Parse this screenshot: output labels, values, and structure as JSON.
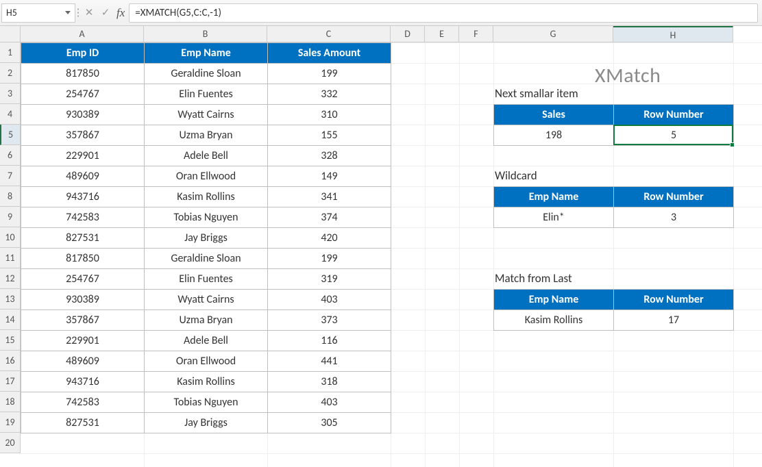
{
  "name_box": "H5",
  "formula": "=XMATCH(G5,C:C,-1)",
  "columns": [
    "A",
    "B",
    "C",
    "D",
    "E",
    "F",
    "G",
    "H"
  ],
  "rows": [
    "1",
    "2",
    "3",
    "4",
    "5",
    "6",
    "7",
    "8",
    "9",
    "10",
    "11",
    "12",
    "13",
    "14",
    "15",
    "16",
    "17",
    "18",
    "19",
    "20"
  ],
  "active_row": "5",
  "active_col": "H",
  "main_table": {
    "headers": [
      "Emp ID",
      "Emp Name",
      "Sales Amount"
    ],
    "rows": [
      [
        "817850",
        "Geraldine Sloan",
        "199"
      ],
      [
        "254767",
        "Elin Fuentes",
        "332"
      ],
      [
        "930389",
        "Wyatt Cairns",
        "310"
      ],
      [
        "357867",
        "Uzma Bryan",
        "155"
      ],
      [
        "229901",
        "Adele Bell",
        "328"
      ],
      [
        "489609",
        "Oran Ellwood",
        "149"
      ],
      [
        "943716",
        "Kasim Rollins",
        "341"
      ],
      [
        "742583",
        "Tobias Nguyen",
        "374"
      ],
      [
        "827531",
        "Jay Briggs",
        "420"
      ],
      [
        "817850",
        "Geraldine Sloan",
        "199"
      ],
      [
        "254767",
        "Elin Fuentes",
        "319"
      ],
      [
        "930389",
        "Wyatt Cairns",
        "403"
      ],
      [
        "357867",
        "Uzma Bryan",
        "373"
      ],
      [
        "229901",
        "Adele Bell",
        "116"
      ],
      [
        "489609",
        "Oran Ellwood",
        "441"
      ],
      [
        "943716",
        "Kasim Rollins",
        "318"
      ],
      [
        "742583",
        "Tobias Nguyen",
        "403"
      ],
      [
        "827531",
        "Jay Briggs",
        "305"
      ]
    ]
  },
  "title": "XMatch",
  "section1": {
    "label": "Next smallar item",
    "headers": [
      "Sales",
      "Row Number"
    ],
    "row": [
      "198",
      "5"
    ]
  },
  "section2": {
    "label": "Wildcard",
    "headers": [
      "Emp Name",
      "Row Number"
    ],
    "row": [
      "Elin*",
      "3"
    ]
  },
  "section3": {
    "label": "Match from Last",
    "headers": [
      "Emp Name",
      "Row Number"
    ],
    "row": [
      "Kasim Rollins",
      "17"
    ]
  }
}
